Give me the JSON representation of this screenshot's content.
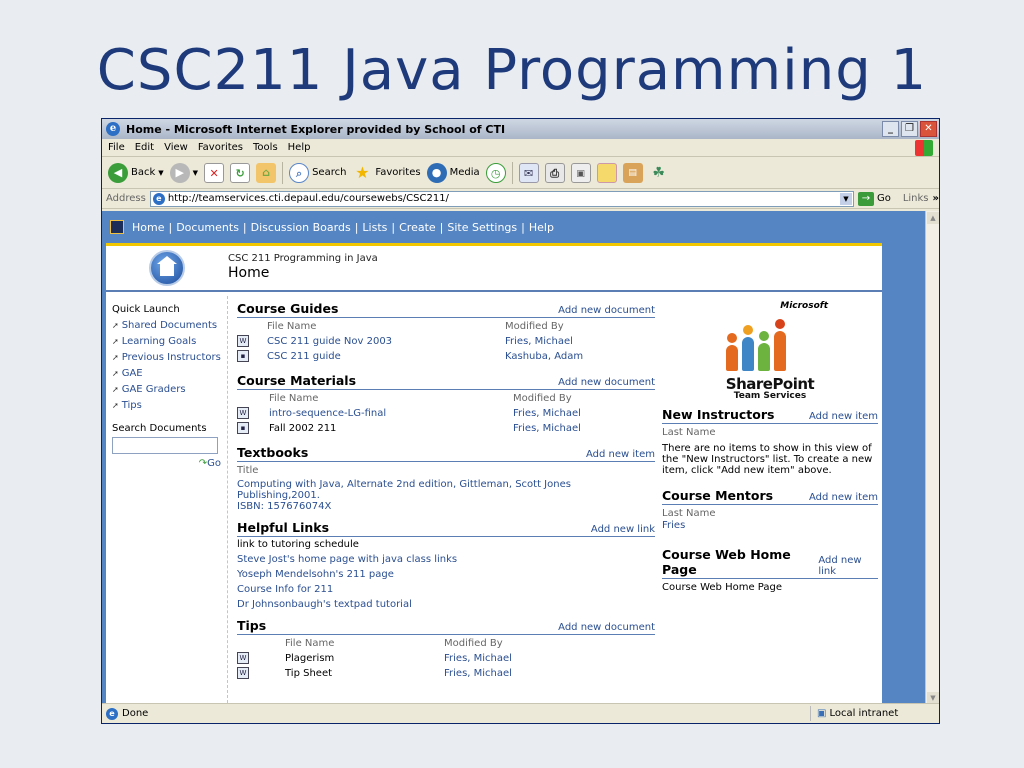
{
  "slide": {
    "title": "CSC211 Java Programming 1"
  },
  "window": {
    "title": "Home - Microsoft Internet Explorer provided by School of CTI",
    "controls": [
      "_",
      "❐",
      "✕"
    ]
  },
  "menu": [
    "File",
    "Edit",
    "View",
    "Favorites",
    "Tools",
    "Help"
  ],
  "toolbar": {
    "back": "Back",
    "search": "Search",
    "favorites": "Favorites",
    "media": "Media"
  },
  "address": {
    "label": "Address",
    "url": "http://teamservices.cti.depaul.edu/coursewebs/CSC211/",
    "go": "Go",
    "links": "Links"
  },
  "status": {
    "text": "Done",
    "zone": "Local intranet"
  },
  "sp_nav": [
    "Home",
    "Documents",
    "Discussion Boards",
    "Lists",
    "Create",
    "Site Settings",
    "Help"
  ],
  "header": {
    "course": "CSC 211 Programming in Java",
    "page": "Home"
  },
  "quick_launch": {
    "title": "Quick Launch",
    "items": [
      "Shared Documents",
      "Learning Goals",
      "Previous Instructors",
      "GAE",
      "GAE Graders",
      "Tips"
    ],
    "search_title": "Search Documents",
    "go": "Go"
  },
  "course_guides": {
    "title": "Course Guides",
    "add": "Add new document",
    "col1": "File Name",
    "col2": "Modified By",
    "rows": [
      {
        "name": "CSC 211 guide Nov 2003",
        "by": "Fries, Michael"
      },
      {
        "name": "CSC 211 guide",
        "by": "Kashuba, Adam"
      }
    ]
  },
  "course_materials": {
    "title": "Course Materials",
    "add": "Add new document",
    "col1": "File Name",
    "col2": "Modified By",
    "rows": [
      {
        "name": "intro-sequence-LG-final",
        "by": "Fries, Michael"
      },
      {
        "name": "Fall 2002 211",
        "by": "Fries, Michael"
      }
    ]
  },
  "textbooks": {
    "title": "Textbooks",
    "add": "Add new item",
    "col": "Title",
    "line1": "Computing with Java, Alternate 2nd edition, Gittleman, Scott Jones Publishing,2001.",
    "line2": "ISBN: 157676074X"
  },
  "helpful_links": {
    "title": "Helpful Links",
    "add": "Add new link",
    "items": [
      "link to tutoring schedule",
      "Steve Jost's home page with java class links",
      "Yoseph Mendelsohn's 211 page",
      "Course Info for 211",
      "Dr Johnsonbaugh's textpad tutorial"
    ]
  },
  "tips": {
    "title": "Tips",
    "add": "Add new document",
    "col1": "File Name",
    "col2": "Modified By",
    "rows": [
      {
        "name": "Plagerism",
        "by": "Fries, Michael"
      },
      {
        "name": "Tip Sheet",
        "by": "Fries, Michael"
      }
    ]
  },
  "branding": {
    "ms": "Microsoft",
    "sp": "SharePoint",
    "sp_sub": "Team Services"
  },
  "new_instructors": {
    "title": "New Instructors",
    "add": "Add new item",
    "col": "Last Name",
    "empty": "There are no items to show in this view of the \"New Instructors\" list. To create a new item, click \"Add new item\" above."
  },
  "course_mentors": {
    "title": "Course Mentors",
    "add": "Add new item",
    "col": "Last Name",
    "row": "Fries"
  },
  "course_web": {
    "title": "Course Web Home Page",
    "add": "Add new link",
    "row": "Course Web Home Page"
  }
}
